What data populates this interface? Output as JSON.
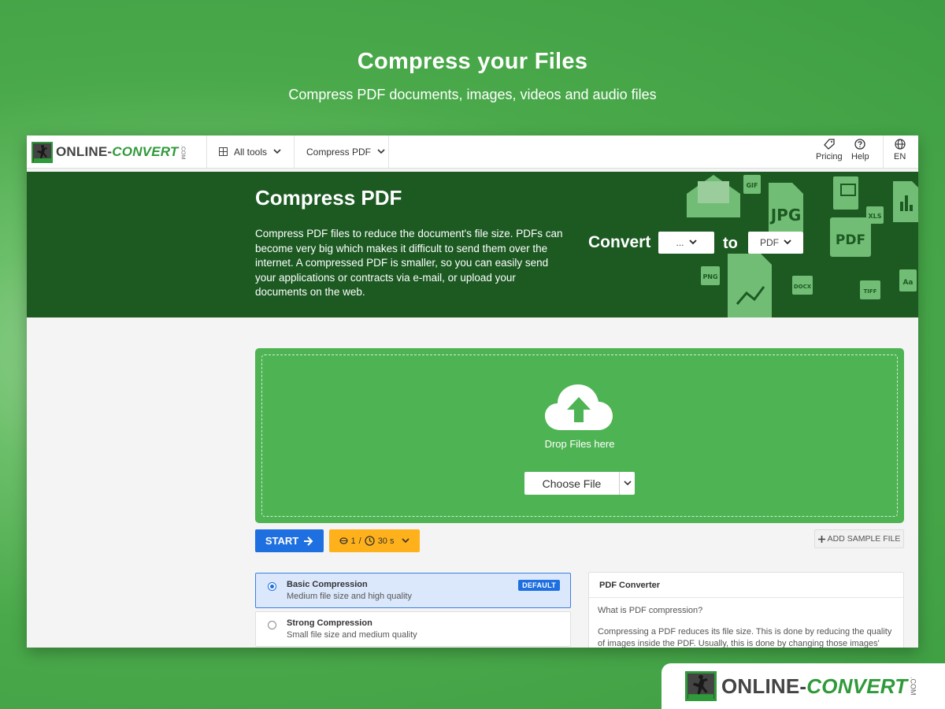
{
  "hero": {
    "title": "Compress your Files",
    "subtitle": "Compress PDF documents, images, videos and audio files"
  },
  "nav": {
    "logo_main": "ONLINE-",
    "logo_accent": "CONVERT",
    "logo_com": ".COM",
    "all_tools": "All tools",
    "compress_pdf": "Compress PDF",
    "pricing": "Pricing",
    "help": "Help",
    "language": "EN"
  },
  "banner": {
    "title": "Compress PDF",
    "description": "Compress PDF files to reduce the document's file size. PDFs can become very big which makes it difficult to send them over the internet. A compressed PDF is smaller, so you can easily send your applications or contracts via e-mail, or upload your documents on the web.",
    "convert_label": "Convert",
    "from_value": "...",
    "to_label": "to",
    "to_value": "PDF",
    "deco_labels": [
      "GIF",
      "JPG",
      "XLS",
      "PDF",
      "PNG",
      "DOCX",
      "TIFF",
      "Aa"
    ]
  },
  "dropzone": {
    "drop_text": "Drop Files here",
    "choose_file": "Choose File"
  },
  "actions": {
    "start": "START",
    "credits": "1",
    "separator": "/",
    "time": "30 s",
    "add_sample": "ADD SAMPLE FILE"
  },
  "options": [
    {
      "title": "Basic Compression",
      "subtitle": "Medium file size and high quality",
      "badge": "DEFAULT",
      "selected": true
    },
    {
      "title": "Strong Compression",
      "subtitle": "Small file size and medium quality",
      "selected": false
    }
  ],
  "info": {
    "header": "PDF Converter",
    "question": "What is PDF compression?",
    "body": "Compressing a PDF reduces its file size. This is done by reducing the quality of images inside the PDF. Usually, this is done by changing those images' DPI"
  },
  "colors": {
    "brand_green": "#2f9a3a",
    "banner_green": "#1c5a22",
    "dropzone_green": "#4eb353",
    "start_blue": "#1e6fe0",
    "credit_orange": "#ffb11b"
  }
}
